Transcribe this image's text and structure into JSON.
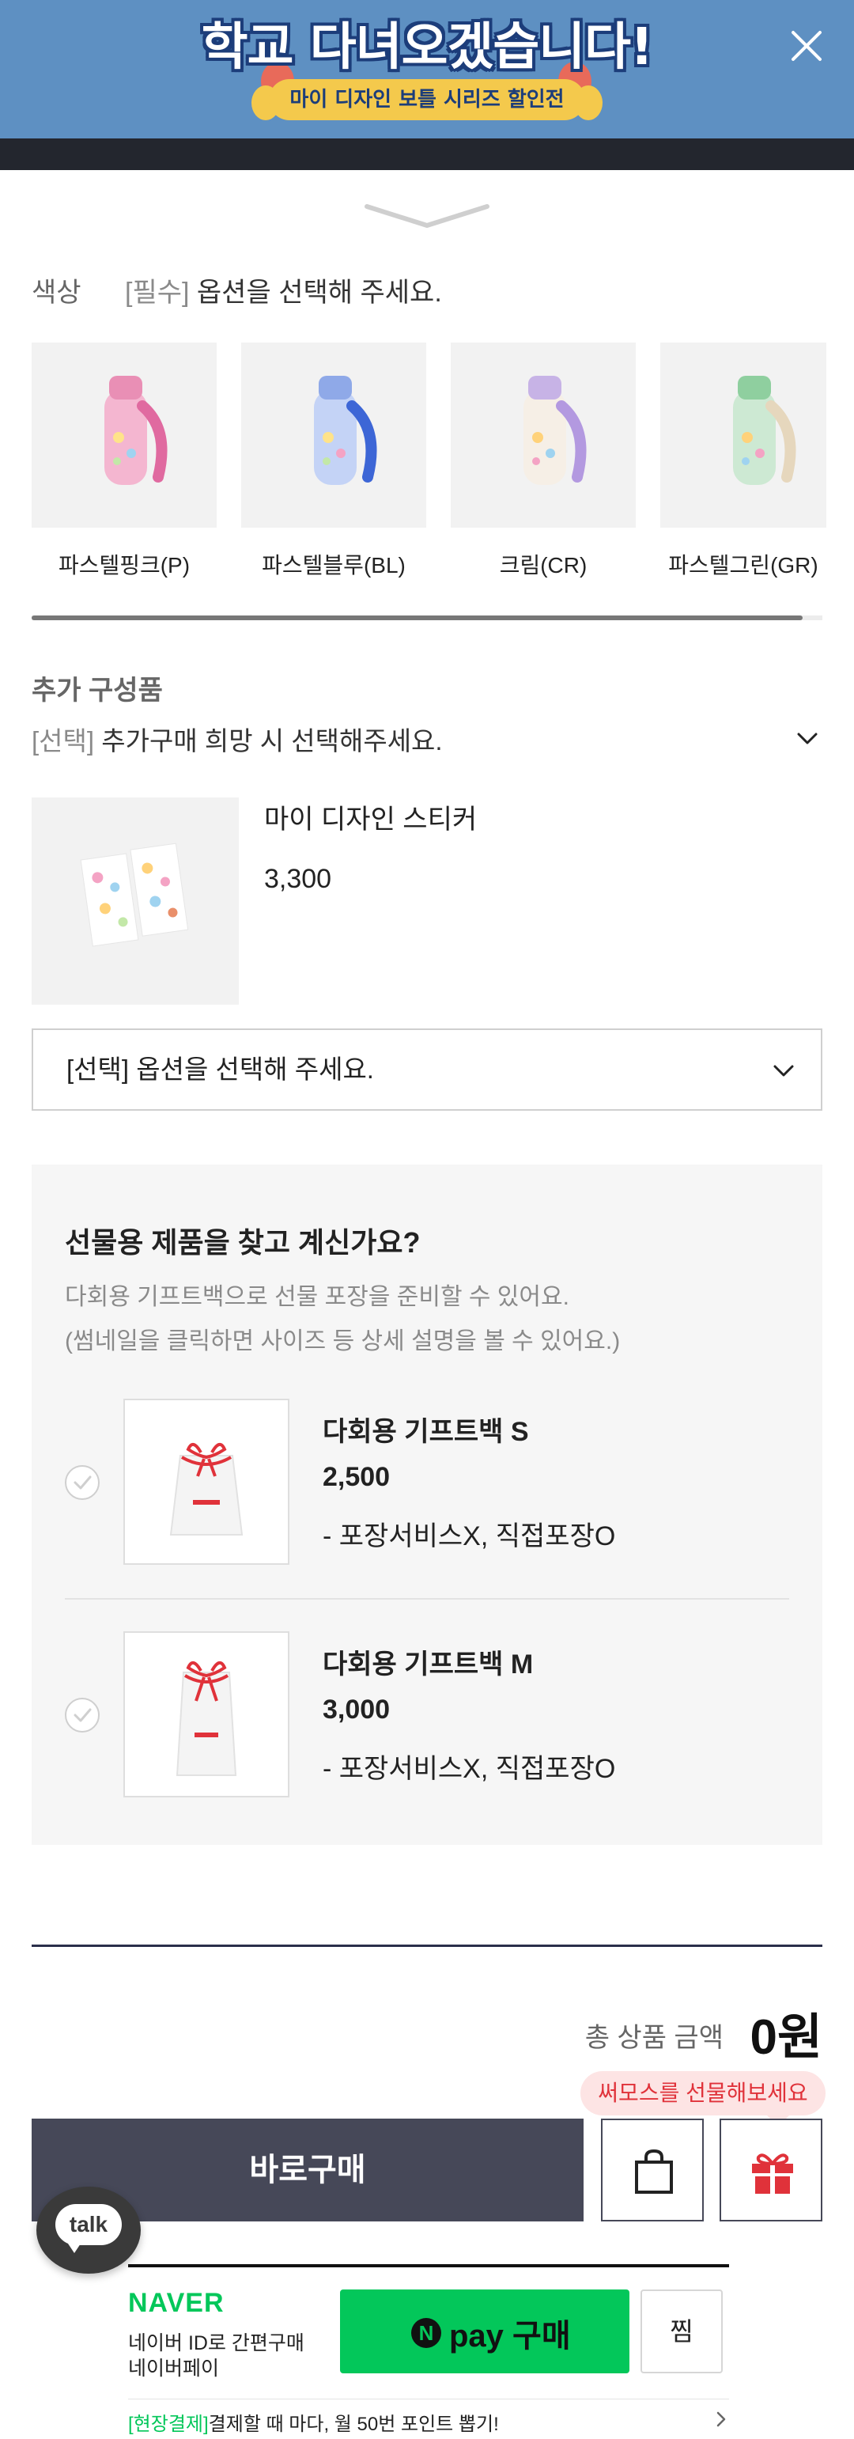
{
  "banner": {
    "title": "학교 다녀오겠습니다!",
    "subtitle": "마이 디자인 보틀 시리즈 할인전"
  },
  "color_option": {
    "label": "색상",
    "required_tag": "[필수]",
    "prompt": "옵션을 선택해 주세요.",
    "swatches": [
      {
        "label": "파스텔핑크(P)",
        "color": "#f4b6d0"
      },
      {
        "label": "파스텔블루(BL)",
        "color": "#a9bff0"
      },
      {
        "label": "크림(CR)",
        "color": "#f1e8dc"
      },
      {
        "label": "파스텔그린(GR)",
        "color": "#b6dcc0"
      }
    ]
  },
  "extra": {
    "title": "추가 구성품",
    "select_tag": "[선택]",
    "select_prompt": "추가구매 희망 시 선택해주세요.",
    "product_name": "마이 디자인 스티커",
    "product_price": "3,300",
    "dropdown_value": "[선택] 옵션을 선택해 주세요."
  },
  "gift": {
    "title": "선물용 제품을 찾고 계신가요?",
    "desc1": "다회용 기프트백으로 선물 포장을 준비할 수 있어요.",
    "desc2": "(썸네일을 클릭하면 사이즈 등 상세 설명을 볼 수 있어요.)",
    "items": [
      {
        "name": "다회용 기프트백 S",
        "price": "2,500",
        "note": "- 포장서비스X, 직접포장O"
      },
      {
        "name": "다회용 기프트백 M",
        "price": "3,000",
        "note": "- 포장서비스X, 직접포장O"
      }
    ]
  },
  "total": {
    "label": "총 상품 금액",
    "value": "0원"
  },
  "actions": {
    "tooltip": "써모스를 선물해보세요",
    "buy_now": "바로구매",
    "talk": "talk"
  },
  "naver": {
    "logo": "NAVER",
    "line1": "네이버 ID로 간편구매",
    "line2": "네이버페이",
    "npay_badge": "N",
    "npay_label": "pay 구매",
    "zzim": "찜",
    "promo_highlight": "[현장결제]",
    "promo_text": "결제할 때 마다, 월 50번 포인트 뽑기!"
  },
  "colors": {
    "banner_bg": "#5e90c2",
    "buy_button": "#464858",
    "naver_green": "#03c75a",
    "gift_red": "#e0323a"
  }
}
